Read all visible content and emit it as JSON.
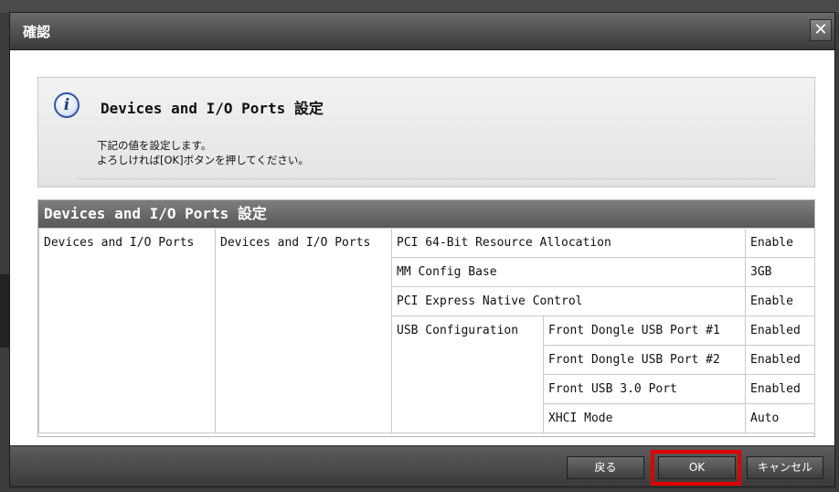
{
  "dialog": {
    "title": "確認",
    "close_glyph": "✕"
  },
  "info": {
    "icon": "i",
    "title": "Devices and I/O Ports 設定",
    "line1": "下記の値を設定します。",
    "line2": "よろしければ[OK]ボタンを押してください。"
  },
  "settings": {
    "header": "Devices and I/O Ports 設定",
    "col1": "Devices and I/O Ports",
    "col2": "Devices and I/O Ports",
    "rows": [
      {
        "name": "PCI 64-Bit Resource Allocation",
        "value": "Enable"
      },
      {
        "name": "MM Config Base",
        "value": "3GB"
      },
      {
        "name": "PCI Express Native Control",
        "value": "Enable"
      }
    ],
    "usb": {
      "label": "USB Configuration",
      "items": [
        {
          "name": "Front Dongle USB Port #1",
          "value": "Enabled"
        },
        {
          "name": "Front Dongle USB Port #2",
          "value": "Enabled"
        },
        {
          "name": "Front USB 3.0 Port",
          "value": "Enabled"
        },
        {
          "name": "XHCI Mode",
          "value": "Auto"
        }
      ]
    }
  },
  "footer": {
    "back": "戻る",
    "ok": "OK",
    "cancel": "キャンセル"
  },
  "colors": {
    "highlight": "#e00000",
    "titlebar": "#4a4a4a",
    "accent_icon": "#2d56a6"
  }
}
